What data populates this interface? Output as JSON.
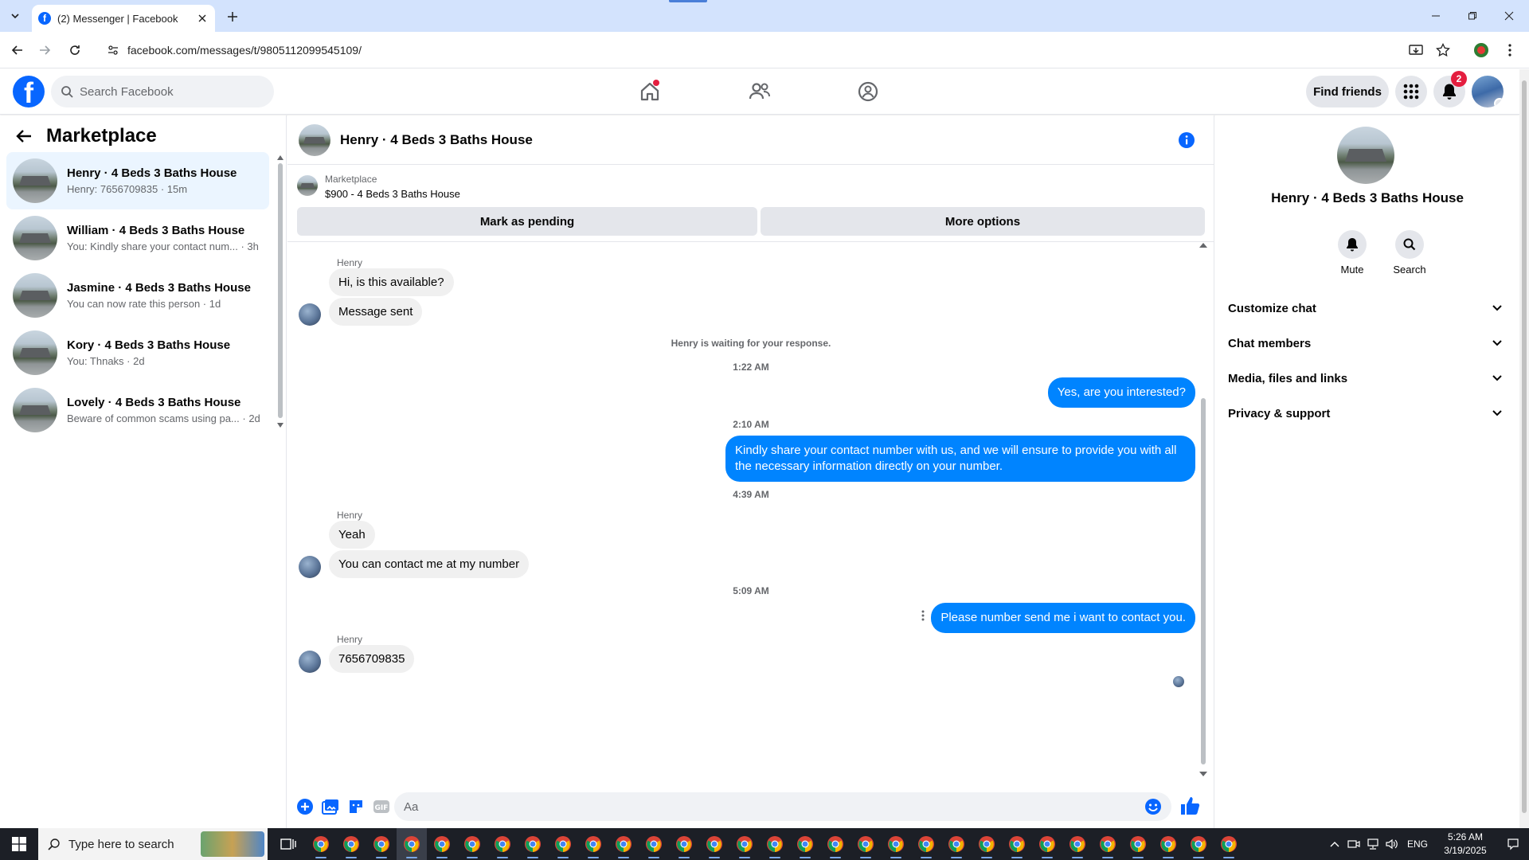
{
  "browser": {
    "tab_title": "(2) Messenger | Facebook",
    "url": "facebook.com/messages/t/9805112099545109/"
  },
  "header": {
    "search_placeholder": "Search Facebook",
    "find_friends": "Find friends",
    "notification_count": "2"
  },
  "sidebar": {
    "title": "Marketplace",
    "chats": [
      {
        "name": "Henry · 4 Beds 3 Baths House",
        "preview": "Henry: 7656709835 · 15m",
        "active": true
      },
      {
        "name": "William · 4 Beds 3 Baths House",
        "preview": "You: Kindly share your contact num... · 3h"
      },
      {
        "name": "Jasmine · 4 Beds 3 Baths House",
        "preview": "You can now rate this person · 1d"
      },
      {
        "name": "Kory · 4 Beds 3 Baths House",
        "preview": "You: Thnaks · 2d"
      },
      {
        "name": "Lovely · 4 Beds 3 Baths House",
        "preview": "Beware of common scams using pa... · 2d"
      }
    ]
  },
  "conversation": {
    "title": "Henry · 4 Beds 3 Baths House",
    "listing": {
      "label": "Marketplace",
      "price_title": "$900 - 4 Beds 3 Baths House",
      "mark_pending": "Mark as pending",
      "more_options": "More options"
    },
    "messages": {
      "sender1": "Henry",
      "m1": "Hi, is this available?",
      "m2": "Message sent",
      "waiting": "Henry is waiting for your response.",
      "t1": "1:22 AM",
      "o1": "Yes, are you interested?",
      "t2": "2:10 AM",
      "o2": "Kindly share your contact number with us, and we will ensure to provide you with all the necessary information directly on your number.",
      "t3": "4:39 AM",
      "sender2": "Henry",
      "m3": "Yeah",
      "m4": "You can contact me at my number",
      "t4": "5:09 AM",
      "o3": "Please number send me i want to contact you.",
      "sender3": "Henry",
      "m5": "7656709835"
    },
    "composer_placeholder": "Aa"
  },
  "info_panel": {
    "name": "Henry · 4 Beds 3 Baths House",
    "mute": "Mute",
    "search": "Search",
    "sections": [
      "Customize chat",
      "Chat members",
      "Media, files and links",
      "Privacy & support"
    ]
  },
  "taskbar": {
    "search_placeholder": "Type here to search",
    "lang": "ENG",
    "time": "5:26 AM",
    "date": "3/19/2025"
  },
  "colors": {
    "facebook_blue": "#0866ff",
    "outgoing_bubble": "#0084ff",
    "incoming_bubble": "#f0f0f0",
    "badge_red": "#e41e3f"
  }
}
